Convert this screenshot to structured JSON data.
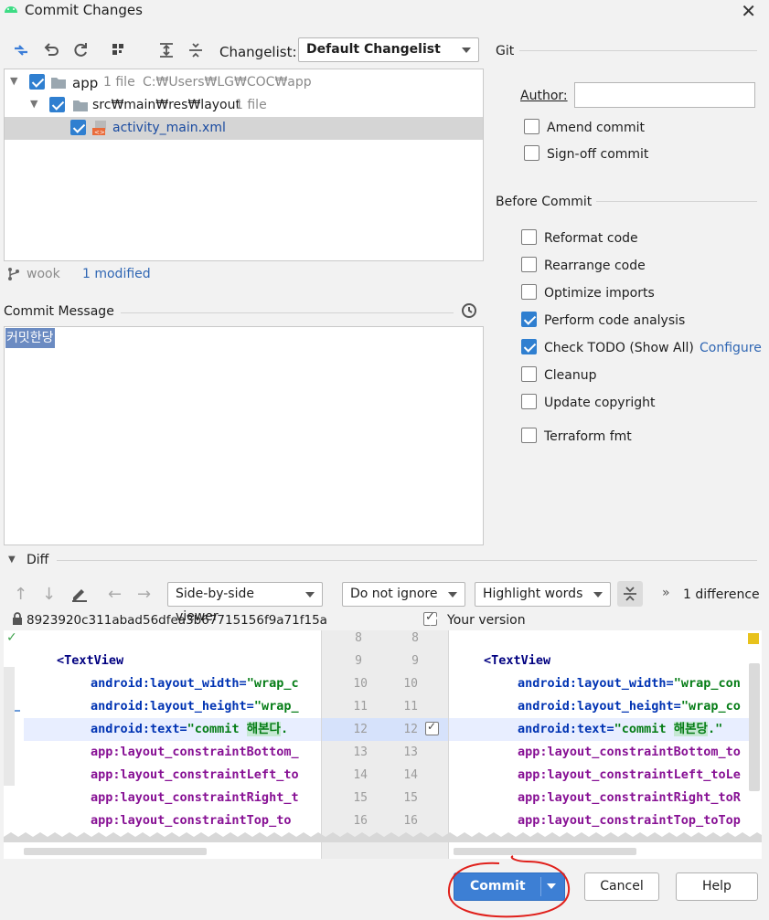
{
  "window": {
    "title": "Commit Changes"
  },
  "toolbar": {
    "changelist_label": "Changelist:",
    "changelist_value": "Default Changelist"
  },
  "tree": [
    {
      "name": "app",
      "meta": "1 file",
      "path": "C:₩Users₩LG₩COC₩app"
    },
    {
      "name": "src₩main₩res₩layout",
      "meta": "1 file"
    },
    {
      "name": "activity_main.xml"
    }
  ],
  "branch": {
    "name": "wook",
    "modified": "1 modified"
  },
  "commit_message": {
    "label": "Commit Message",
    "value": "커밋한당"
  },
  "git": {
    "section_title": "Git",
    "author_label": "Author:",
    "author_value": "",
    "options": [
      {
        "label": "Amend commit",
        "checked": false
      },
      {
        "label": "Sign-off commit",
        "checked": false
      }
    ]
  },
  "before_commit": {
    "section_title": "Before Commit",
    "options": [
      {
        "label": "Reformat code",
        "checked": false
      },
      {
        "label": "Rearrange code",
        "checked": false
      },
      {
        "label": "Optimize imports",
        "checked": false
      },
      {
        "label": "Perform code analysis",
        "checked": true
      },
      {
        "label": "Check TODO (Show All)",
        "checked": true
      },
      {
        "label": "Cleanup",
        "checked": false
      },
      {
        "label": "Update copyright",
        "checked": false
      },
      {
        "label": "Terraform fmt",
        "checked": false
      }
    ],
    "configure_link": "Configure"
  },
  "diff": {
    "title": "Diff",
    "viewer": "Side-by-side viewer",
    "ignore": "Do not ignore",
    "highlight": "Highlight words",
    "differences": "1 difference",
    "left_hash": "8923920c311abad56dfea3b67715156f9a71f15a",
    "right_label": "Your version",
    "line_numbers": [
      "8",
      "9",
      "10",
      "11",
      "12",
      "13",
      "14",
      "15",
      "16"
    ],
    "left_lines": {
      "tag": "<TextView",
      "l10a": "android:layout_width=",
      "l10b": "\"wrap_c",
      "l11a": "android:layout_height=",
      "l11b": "\"wrap_",
      "l12a": "android:text=",
      "l12b": "\"commit ",
      "l12c": "해본다",
      "l12d": ".",
      "l13": "app:layout_constraintBottom_",
      "l14": "app:layout_constraintLeft_to",
      "l15": "app:layout_constraintRight_t",
      "l16": "app:layout_constraintTop_to"
    },
    "right_lines": {
      "tag": "<TextView",
      "l10a": "android:layout_width=",
      "l10b": "\"wrap_con",
      "l11a": "android:layout_height=",
      "l11b": "\"wrap_co",
      "l12a": "android:text=",
      "l12b": "\"commit ",
      "l12c": "해본당",
      "l12d": ".\"",
      "l13": "app:layout_constraintBottom_to",
      "l14": "app:layout_constraintLeft_toLe",
      "l15": "app:layout_constraintRight_toR",
      "l16": "app:layout_constraintTop_toTop"
    }
  },
  "buttons": {
    "commit": "Commit",
    "cancel": "Cancel",
    "help": "Help"
  },
  "colors": {
    "accent": "#3d7fd4",
    "annotation_circle": "#e0201b",
    "selection": "#6b8bc2"
  }
}
